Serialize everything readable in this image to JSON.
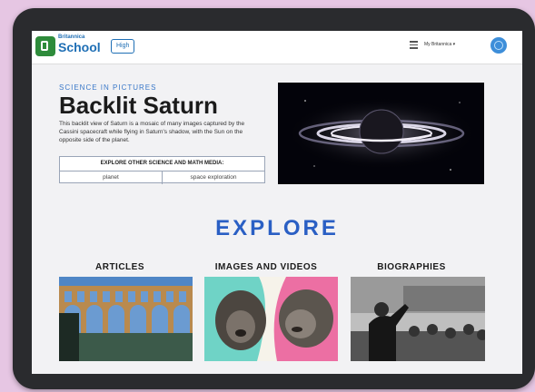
{
  "header": {
    "brand_top": "Britannica",
    "brand_main": "School",
    "level": "High",
    "account": "My Britannica ▾"
  },
  "feature": {
    "eyebrow": "SCIENCE IN PICTURES",
    "title": "Backlit Saturn",
    "description": "This backlit view of Saturn is a mosaic of many images captured by the Cassini spacecraft while flying in Saturn's shadow, with the Sun on the opposite side of the planet.",
    "media_header": "EXPLORE OTHER SCIENCE AND MATH MEDIA:",
    "media_links": [
      "planet",
      "space exploration"
    ]
  },
  "explore": {
    "heading": "EXPLORE",
    "categories": [
      "ARTICLES",
      "IMAGES AND VIDEOS",
      "BIOGRAPHIES"
    ]
  },
  "icons": [
    "menu-icon",
    "user-icon",
    "globe-icon"
  ],
  "colors": {
    "accent": "#2a5fc4",
    "brand": "#1f6fb5",
    "logo": "#2e8b3b"
  }
}
